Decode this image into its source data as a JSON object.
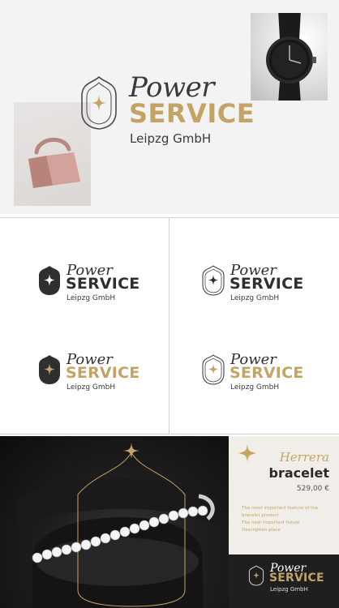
{
  "brand": {
    "power": "Power",
    "service": "SERVICE",
    "subtitle": "Leipzg GmbH"
  },
  "colors": {
    "gold": "#c4a464",
    "dark": "#2f2f2f",
    "background": "#f3f3f3",
    "bracelet_card": "#f1eee9"
  },
  "icons": {
    "logo_mark": "four-point-star-in-arch",
    "product_star": "four-point-star"
  },
  "product": {
    "name_italic": "Herrera",
    "name_bold": "bracelet",
    "price": "529,00 €",
    "description_lines": [
      "The most important feature of the",
      "bracelet product",
      "The next important future",
      "Description place"
    ]
  }
}
